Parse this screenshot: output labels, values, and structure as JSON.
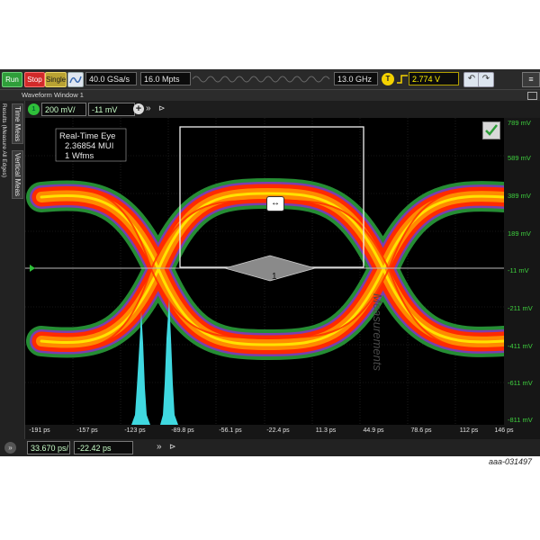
{
  "toolbar": {
    "run_label": "Run",
    "stop_label": "Stop",
    "single_label": "Single",
    "sample_rate": "40.0 GSa/s",
    "memory_depth": "16.0 Mpts",
    "bandwidth": "13.0 GHz",
    "trigger_icon_label": "T",
    "trigger_level": "2.774 V",
    "colors": {
      "run": "#2f9e3a",
      "stop": "#d22a2a",
      "single": "#b9a233",
      "trigger": "#f4d200"
    }
  },
  "window": {
    "title": "Waveform Window 1"
  },
  "side_tabs": {
    "results": "Results (Measure All Edges)",
    "time_meas": "Time Meas",
    "vertical_meas": "Vertical Meas"
  },
  "channel": {
    "number": "1",
    "scale": "200 mV/",
    "offset": "-11 mV",
    "color": "#2fbf3a"
  },
  "eye": {
    "label_lines": [
      "Real-Time Eye",
      "2.36854 MUI",
      "1 Wfms"
    ],
    "marker": "1",
    "watermark": "Measurements",
    "colors": [
      "#2a9d3a",
      "#7a3fb0",
      "#ff2a00",
      "#ff8a00",
      "#ffe200"
    ]
  },
  "y_axis": {
    "labels": [
      "789 mV",
      "589 mV",
      "389 mV",
      "189 mV",
      "-11 mV",
      "-211 mV",
      "-411 mV",
      "-611 mV",
      "-811 mV"
    ],
    "color": "#3ed03e"
  },
  "x_axis": {
    "labels": [
      "-191 ps",
      "-157 ps",
      "-123 ps",
      "-89.8 ps",
      "-56.1 ps",
      "-22.4 ps",
      "11.3 ps",
      "44.9 ps",
      "78.6 ps",
      "112 ps",
      "146 ps"
    ]
  },
  "timebase": {
    "scale": "33.670 ps/",
    "position": "-22.42 ps"
  },
  "histogram": {
    "color": "#3fd8e0"
  },
  "caption": "aaa-031497"
}
